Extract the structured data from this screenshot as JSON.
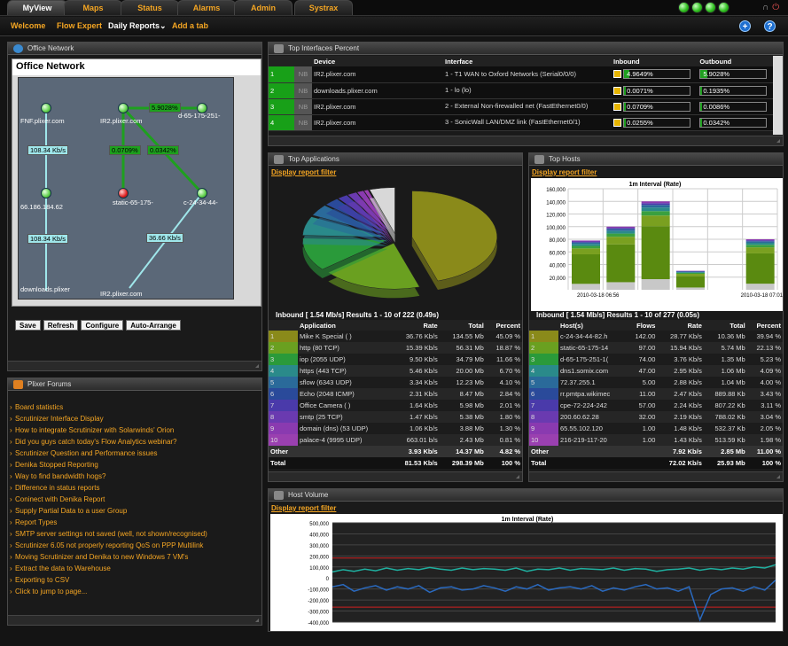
{
  "tabs": [
    "MyView",
    "Maps",
    "Status",
    "Alarms",
    "Admin",
    "Systrax"
  ],
  "subnav": {
    "welcome": "Welcome",
    "flow_expert": "Flow Expert",
    "daily_reports": "Daily Reports",
    "add_tab": "Add a tab"
  },
  "colors": {
    "accent": "#f5a623",
    "green": "#1fa01f"
  },
  "office": {
    "panel_title": "Office Network",
    "map_title": "Office Network",
    "nodes": {
      "fnf": "FNF.plixer.com",
      "ir2a": "IR2.plixer.com",
      "d65": "d-65-175-251-",
      "ip66": "66.186.184.62",
      "static": "static-65-175-",
      "c24": "c-24-34-44-",
      "downloads": "downloads.plixer",
      "ir2b": "IR2.plixer.com"
    },
    "edges": {
      "e1": "5.9028%",
      "e2": "108.34 Kb/s",
      "e3": "0.0709%",
      "e4": "0.0342%",
      "e5": "108.34 Kb/s",
      "e6": "36.66 Kb/s"
    },
    "buttons": {
      "save": "Save",
      "refresh": "Refresh",
      "configure": "Configure",
      "arrange": "Auto-Arrange"
    }
  },
  "forums": {
    "title": "Plixer Forums",
    "items": [
      "Board statistics",
      "Scrutinizer Interface Display",
      "How to integrate Scrutinizer with Solarwinds' Orion",
      "Did you guys catch today's Flow Analytics webinar?",
      "Scrutinizer Question and Performance issues",
      "Denika Stopped Reporting",
      "Way to find bandwidth hogs?",
      "Difference in status reports",
      "Coninect with Denika Report",
      "Supply Partial Data to a user Group",
      "Report Types",
      "SMTP server settings not saved (well, not shown/recognised)",
      "Scrutinizer 6.05 not properly reporting QoS on PPP Multilink",
      "Moving Scrutinizer and Denika to new Windows 7 VM's",
      "Extract the data to Warehouse",
      "Exporting to CSV",
      "Click to jump to page..."
    ]
  },
  "interfaces": {
    "title": "Top Interfaces Percent",
    "headers": {
      "device": "Device",
      "interface": "Interface",
      "inbound": "Inbound",
      "outbound": "Outbound"
    },
    "rows": [
      {
        "idx": "1",
        "dot": "NB",
        "device": "IR2.plixer.com",
        "iface": "1 - T1 WAN to Oxford Networks (Serial0/0/0)",
        "in": "4.9649%",
        "in_pct": 4.9649,
        "out": "5.9028%",
        "out_pct": 5.9028
      },
      {
        "idx": "2",
        "dot": "NB",
        "device": "downloads.plixer.com",
        "iface": "1 - lo (lo)",
        "in": "0.0071%",
        "in_pct": 0.0071,
        "out": "0.1935%",
        "out_pct": 0.1935
      },
      {
        "idx": "3",
        "dot": "NB",
        "device": "IR2.plixer.com",
        "iface": "2 - External Non-firewalled net (FastEthernet0/0)",
        "in": "0.0709%",
        "in_pct": 0.0709,
        "out": "0.0086%",
        "out_pct": 0.0086
      },
      {
        "idx": "4",
        "dot": "NB",
        "device": "IR2.plixer.com",
        "iface": "3 - SonicWall LAN/DMZ link (FastEthernet0/1)",
        "in": "0.0255%",
        "in_pct": 0.0255,
        "out": "0.0342%",
        "out_pct": 0.0342
      }
    ]
  },
  "apps": {
    "title": "Top Applications",
    "filter": "Display report filter",
    "subtitle": "Inbound [ 1.54 Mb/s] Results 1 - 10 of 222 (0.49s)",
    "headers": {
      "app": "Application",
      "rate": "Rate",
      "total": "Total",
      "pct": "Percent"
    },
    "rows": [
      {
        "n": "1",
        "name": "Mike K Special ( )",
        "rate": "36.76 Kb/s",
        "total": "134.55 Mb",
        "pct": "45.09 %",
        "color": "#8a8a1a"
      },
      {
        "n": "2",
        "name": "http (80 TCP)",
        "rate": "15.39 Kb/s",
        "total": "56.31 Mb",
        "pct": "18.87 %",
        "color": "#6aa020"
      },
      {
        "n": "3",
        "name": "iop (2055 UDP)",
        "rate": "9.50 Kb/s",
        "total": "34.79 Mb",
        "pct": "11.66 %",
        "color": "#2a9a3a"
      },
      {
        "n": "4",
        "name": "https (443 TCP)",
        "rate": "5.46 Kb/s",
        "total": "20.00 Mb",
        "pct": "6.70 %",
        "color": "#2a8a8a"
      },
      {
        "n": "5",
        "name": "sflow (6343 UDP)",
        "rate": "3.34 Kb/s",
        "total": "12.23 Mb",
        "pct": "4.10 %",
        "color": "#2a6a9a"
      },
      {
        "n": "6",
        "name": "Echo (2048 ICMP)",
        "rate": "2.31 Kb/s",
        "total": "8.47 Mb",
        "pct": "2.84 %",
        "color": "#2a4a9a"
      },
      {
        "n": "7",
        "name": "Office Camera ( )",
        "rate": "1.64 Kb/s",
        "total": "5.98 Mb",
        "pct": "2.01 %",
        "color": "#4a3aaa"
      },
      {
        "n": "8",
        "name": "smtp (25 TCP)",
        "rate": "1.47 Kb/s",
        "total": "5.38 Mb",
        "pct": "1.80 %",
        "color": "#6a3ab0"
      },
      {
        "n": "9",
        "name": "domain (dns) (53 UDP)",
        "rate": "1.06 Kb/s",
        "total": "3.88 Mb",
        "pct": "1.30 %",
        "color": "#8a3ab0"
      },
      {
        "n": "10",
        "name": "palace-4 (9995 UDP)",
        "rate": "663.01 b/s",
        "total": "2.43 Mb",
        "pct": "0.81 %",
        "color": "#9a40b0"
      }
    ],
    "other": {
      "label": "Other",
      "rate": "3.93 Kb/s",
      "total": "14.37 Mb",
      "pct": "4.82 %"
    },
    "total": {
      "label": "Total",
      "rate": "81.53 Kb/s",
      "total": "298.39 Mb",
      "pct": "100 %"
    }
  },
  "hosts": {
    "title": "Top Hosts",
    "filter": "Display report filter",
    "subtitle": "Inbound [ 1.54 Mb/s] Results 1 - 10 of 277 (0.05s)",
    "headers": {
      "host": "Host(s)",
      "flows": "Flows",
      "rate": "Rate",
      "total": "Total",
      "pct": "Percent"
    },
    "rows": [
      {
        "n": "1",
        "name": "c-24-34-44-82.h",
        "flows": "142.00",
        "rate": "28.77 Kb/s",
        "total": "10.36 Mb",
        "pct": "39.94 %",
        "color": "#8a8a1a"
      },
      {
        "n": "2",
        "name": "static-65-175-14",
        "flows": "97.00",
        "rate": "15.94 Kb/s",
        "total": "5.74 Mb",
        "pct": "22.13 %",
        "color": "#6aa020"
      },
      {
        "n": "3",
        "name": "d-65-175-251-1(",
        "flows": "74.00",
        "rate": "3.76 Kb/s",
        "total": "1.35 Mb",
        "pct": "5.23 %",
        "color": "#2a9a3a"
      },
      {
        "n": "4",
        "name": "dns1.somix.com",
        "flows": "47.00",
        "rate": "2.95 Kb/s",
        "total": "1.06 Mb",
        "pct": "4.09 %",
        "color": "#2a8a8a"
      },
      {
        "n": "5",
        "name": "72.37.255.1",
        "flows": "5.00",
        "rate": "2.88 Kb/s",
        "total": "1.04 Mb",
        "pct": "4.00 %",
        "color": "#2a6a9a"
      },
      {
        "n": "6",
        "name": "rr.pmtpa.wikimec",
        "flows": "11.00",
        "rate": "2.47 Kb/s",
        "total": "889.88 Kb",
        "pct": "3.43 %",
        "color": "#2a4a9a"
      },
      {
        "n": "7",
        "name": "cpe-72-224-242",
        "flows": "57.00",
        "rate": "2.24 Kb/s",
        "total": "807.22 Kb",
        "pct": "3.11 %",
        "color": "#4a3aaa"
      },
      {
        "n": "8",
        "name": "200.60.62.28",
        "flows": "32.00",
        "rate": "2.19 Kb/s",
        "total": "788.02 Kb",
        "pct": "3.04 %",
        "color": "#6a3ab0"
      },
      {
        "n": "9",
        "name": "65.55.102.120",
        "flows": "1.00",
        "rate": "1.48 Kb/s",
        "total": "532.37 Kb",
        "pct": "2.05 %",
        "color": "#8a3ab0"
      },
      {
        "n": "10",
        "name": "216-219-117-20",
        "flows": "1.00",
        "rate": "1.43 Kb/s",
        "total": "513.59 Kb",
        "pct": "1.98 %",
        "color": "#9a40b0"
      }
    ],
    "other": {
      "label": "Other",
      "flows": "",
      "rate": "7.92 Kb/s",
      "total": "2.85 Mb",
      "pct": "11.00 %"
    },
    "total": {
      "label": "Total",
      "flows": "",
      "rate": "72.02 Kb/s",
      "total": "25.93 Mb",
      "pct": "100 %"
    }
  },
  "volume": {
    "title": "Host Volume",
    "filter": "Display report filter"
  },
  "chart_data": [
    {
      "type": "pie",
      "title": "",
      "categories": [
        "Mike K Special ( )",
        "http (80 TCP)",
        "iop (2055 UDP)",
        "https (443 TCP)",
        "sflow (6343 UDP)",
        "Echo (2048 ICMP)",
        "Office Camera ( )",
        "smtp (25 TCP)",
        "domain (dns) (53 UDP)",
        "palace-4 (9995 UDP)",
        "Other"
      ],
      "values": [
        45.09,
        18.87,
        11.66,
        6.7,
        4.1,
        2.84,
        2.01,
        1.8,
        1.3,
        0.81,
        4.82
      ]
    },
    {
      "type": "bar",
      "title": "1m Interval (Rate)",
      "x": [
        "2010-03-18 06:56",
        "",
        "",
        "",
        "",
        "2010-03-18 07:01"
      ],
      "ylim": [
        0,
        160000
      ],
      "yticks": [
        "160,000",
        "140,000",
        "120,000",
        "100,000",
        "80,000",
        "60,000",
        "40,000",
        "20,000"
      ],
      "xticks": [
        "2010-03-18 06:56",
        "2010-03-18 07:01"
      ],
      "values": [
        78000,
        100000,
        140000,
        30000,
        0,
        80000
      ]
    },
    {
      "type": "line",
      "title": "1m Interval (Rate)",
      "ylim": [
        -400000,
        500000
      ],
      "yticks": [
        "500,000",
        "400,000",
        "300,000",
        "200,000",
        "100,000",
        "0",
        "-100,000",
        "-200,000",
        "-300,000",
        "-400,000"
      ],
      "series": [
        {
          "color": "#1fb0a0",
          "values": [
            55000,
            75000,
            60000,
            80000,
            65000,
            90000,
            70000,
            85000,
            75000,
            95000,
            80000,
            70000,
            90000,
            75000,
            85000,
            80000,
            70000,
            90000,
            60000,
            80000,
            75000,
            90000,
            70000,
            85000,
            80000,
            75000,
            90000,
            70000,
            85000,
            80000,
            60000,
            75000,
            80000,
            90000,
            70000,
            85000,
            75000,
            90000,
            80000,
            100000,
            90000,
            120000
          ]
        },
        {
          "color": "#2a6ac0",
          "values": [
            -80000,
            -60000,
            -120000,
            -90000,
            -70000,
            -110000,
            -80000,
            -100000,
            -70000,
            -130000,
            -90000,
            -80000,
            -110000,
            -100000,
            -70000,
            -90000,
            -120000,
            -80000,
            -100000,
            -60000,
            -110000,
            -90000,
            -80000,
            -100000,
            -70000,
            -120000,
            -90000,
            -110000,
            -80000,
            -60000,
            -100000,
            -90000,
            -120000,
            -80000,
            -380000,
            -150000,
            -100000,
            -90000,
            -120000,
            -80000,
            -110000,
            -20000
          ]
        }
      ]
    }
  ]
}
